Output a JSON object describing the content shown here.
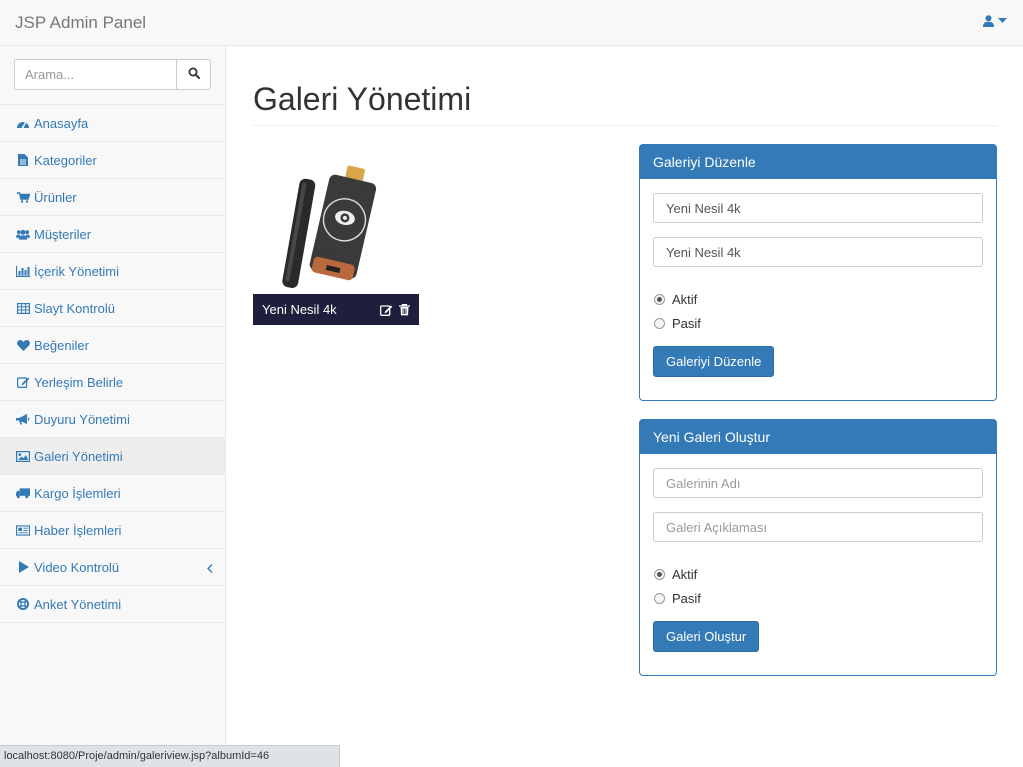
{
  "navbar": {
    "brand": "JSP Admin Panel",
    "user_icon": "user-icon",
    "caret_icon": "caret-down-icon"
  },
  "sidebar": {
    "search": {
      "placeholder": "Arama...",
      "button_icon": "search-icon"
    },
    "items": [
      {
        "label": "Anasayfa",
        "icon": "dashboard-icon",
        "active": false
      },
      {
        "label": "Kategoriler",
        "icon": "file-text-icon",
        "active": false
      },
      {
        "label": "Ürünler",
        "icon": "shopping-cart-icon",
        "active": false
      },
      {
        "label": "Müşteriler",
        "icon": "users-icon",
        "active": false
      },
      {
        "label": "İçerik Yönetimi",
        "icon": "bar-chart-icon",
        "active": false
      },
      {
        "label": "Slayt Kontrolü",
        "icon": "table-icon",
        "active": false
      },
      {
        "label": "Beğeniler",
        "icon": "heart-icon",
        "active": false
      },
      {
        "label": "Yerleşim Belirle",
        "icon": "edit-icon",
        "active": false
      },
      {
        "label": "Duyuru Yönetimi",
        "icon": "bullhorn-icon",
        "active": false
      },
      {
        "label": "Galeri Yönetimi",
        "icon": "image-icon",
        "active": true
      },
      {
        "label": "Kargo İşlemleri",
        "icon": "truck-icon",
        "active": false
      },
      {
        "label": "Haber İşlemleri",
        "icon": "newspaper-icon",
        "active": false
      },
      {
        "label": "Video Kontrolü",
        "icon": "play-icon",
        "active": false,
        "expand_icon": "chevron-left-icon"
      },
      {
        "label": "Anket Yönetimi",
        "icon": "life-ring-icon",
        "active": false
      }
    ]
  },
  "main": {
    "title": "Galeri Yönetimi",
    "gallery": {
      "name": "Yeni Nesil 4k",
      "edit_icon": "edit-icon",
      "delete_icon": "trash-icon"
    },
    "edit_panel": {
      "title": "Galeriyi Düzenle",
      "name_value": "Yeni Nesil 4k",
      "description_value": "Yeni Nesil 4k",
      "radio_active": "Aktif",
      "radio_passive": "Pasif",
      "selected": "Aktif",
      "button": "Galeriyi Düzenle"
    },
    "create_panel": {
      "title": "Yeni Galeri Oluştur",
      "name_placeholder": "Galerinin Adı",
      "description_placeholder": "Galeri Açıklaması",
      "radio_active": "Aktif",
      "radio_passive": "Pasif",
      "selected": "Aktif",
      "button": "Galeri Oluştur"
    }
  },
  "statusbar": {
    "url": "localhost:8080/Proje/admin/galeriview.jsp?albumId=46"
  },
  "colors": {
    "primary": "#337ab7",
    "gallery_bar": "#1f1f3d",
    "navbar_bg": "#f8f8f8"
  }
}
